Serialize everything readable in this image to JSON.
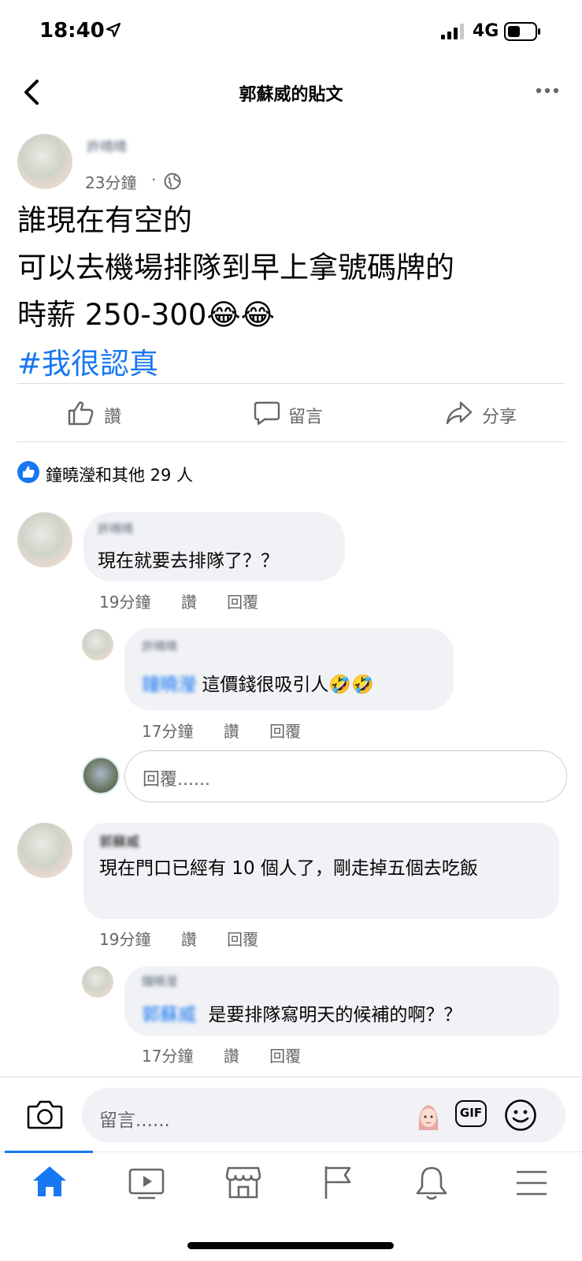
{
  "status_bar": {
    "time": "18:40",
    "network": "4G"
  },
  "header": {
    "title": "郭蘇威的貼文"
  },
  "post": {
    "author": "許晴晴",
    "time": "23分鐘",
    "separator": "·",
    "lines": [
      "誰現在有空的",
      "可以去機場排隊到早上拿號碼牌的",
      "時薪 250-300"
    ],
    "emoji": "😂😂",
    "hashtag": "#我很認真"
  },
  "actions": {
    "like": "讚",
    "comment": "留言",
    "share": "分享"
  },
  "reactions": {
    "summary": "鐘曉瀅和其他 29 人"
  },
  "comments": [
    {
      "author": "許晴晴",
      "text": "現在就要去排隊了？？",
      "time": "19分鐘",
      "like": "讚",
      "reply": "回覆"
    },
    {
      "author": "郭蘇威",
      "text": "現在門口已經有 10 個人了，剛走掉五個去吃飯",
      "time": "19分鐘",
      "like": "讚",
      "reply": "回覆"
    }
  ],
  "replies": [
    {
      "author": "許晴晴",
      "mention": "鐘曉瀅",
      "text": "這價錢很吸引人🤣🤣",
      "time": "17分鐘",
      "like": "讚",
      "reply": "回覆"
    },
    {
      "author": "鐘曉瀅",
      "mention": "郭蘇威",
      "text": "是要排隊寫明天的候補的啊？？",
      "time": "17分鐘",
      "like": "讚",
      "reply": "回覆"
    }
  ],
  "reply_input": {
    "placeholder": "回覆......"
  },
  "comment_input": {
    "placeholder": "留言......",
    "gif": "GIF"
  },
  "colors": {
    "link": "#1877f2",
    "bubble": "#f0f2f5",
    "muted": "#65676b"
  },
  "icons": [
    "back-icon",
    "more-icon",
    "globe-icon",
    "like-icon",
    "comment-icon",
    "share-icon",
    "camera-icon",
    "avatar-sticker-icon",
    "gif-icon",
    "smiley-icon",
    "home-icon",
    "watch-icon",
    "marketplace-icon",
    "pages-icon",
    "bell-icon",
    "menu-icon"
  ]
}
